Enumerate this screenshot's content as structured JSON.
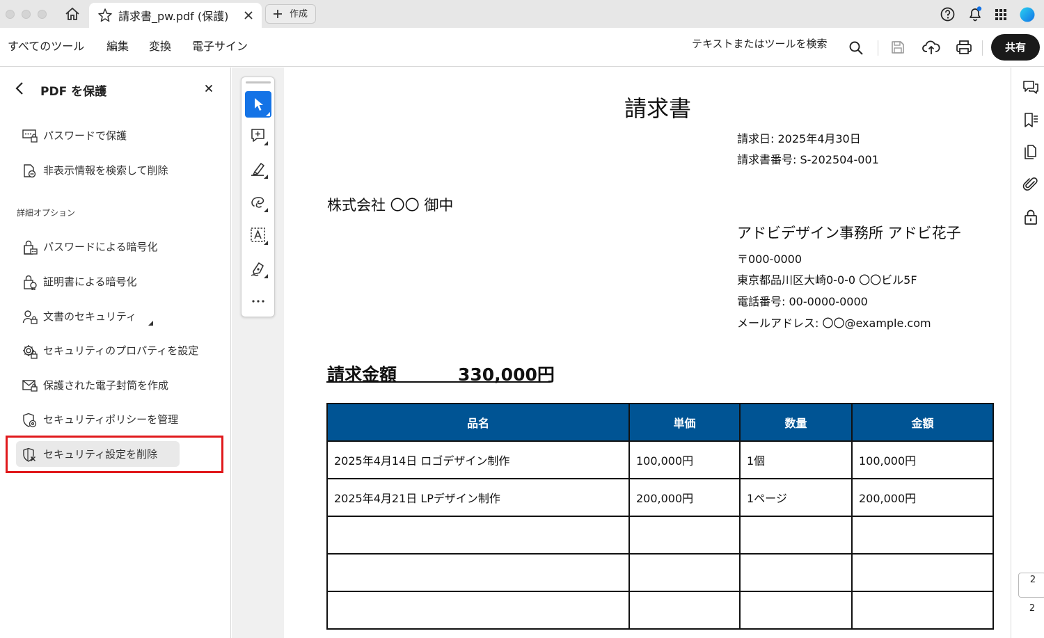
{
  "window": {
    "tab_title": "請求書_pw.pdf (保護)",
    "new_tab_label": "作成"
  },
  "menu": {
    "items": [
      "すべてのツール",
      "編集",
      "変換",
      "電子サイン"
    ],
    "search_label": "テキストまたはツールを検索",
    "share_label": "共有"
  },
  "left_panel": {
    "title": "PDF を保護",
    "items": [
      "パスワードで保護",
      "非表示情報を検索して削除"
    ],
    "section_label": "詳細オプション",
    "advanced_items": [
      "パスワードによる暗号化",
      "証明書による暗号化",
      "文書のセキュリティ",
      "セキュリティのプロパティを設定",
      "保護された電子封筒を作成",
      "セキュリティポリシーを管理",
      "セキュリティ設定を削除"
    ],
    "highlight_color": "#e0191c"
  },
  "toolbar": {
    "accent": "#1473e6"
  },
  "document": {
    "title": "請求書",
    "invoice_date": "請求日: 2025年4月30日",
    "invoice_number": "請求書番号: S-202504-001",
    "client": "株式会社 〇〇 御中",
    "company": "アドビデザイン事務所 アドビ花子",
    "postal": "〒000-0000",
    "address": "東京都品川区大崎0-0-0 〇〇ビル5F",
    "phone": "電話番号: 00-0000-0000",
    "email": "メールアドレス: 〇〇@example.com",
    "amount_label": "請求金額",
    "amount_value": "330,000円",
    "table": {
      "header_color": "#005494",
      "headers": [
        "品名",
        "単価",
        "数量",
        "金額"
      ],
      "rows": [
        [
          "2025年4月14日 ロゴデザイン制作",
          "100,000円",
          "1個",
          "100,000円"
        ],
        [
          "2025年4月21日 LPデザイン制作",
          "200,000円",
          "1ページ",
          "200,000円"
        ],
        [
          "",
          "",
          "",
          ""
        ],
        [
          "",
          "",
          "",
          ""
        ],
        [
          "",
          "",
          "",
          ""
        ]
      ]
    }
  },
  "pagination": {
    "current": "2",
    "total": "2"
  }
}
